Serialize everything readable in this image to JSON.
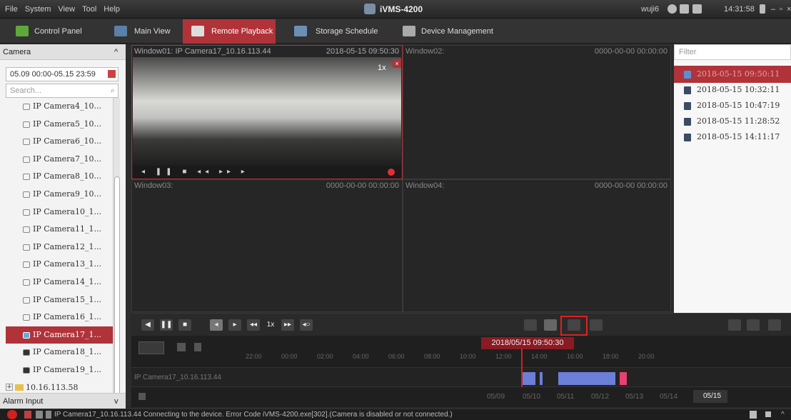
{
  "menubar": {
    "items": [
      "File",
      "System",
      "View",
      "Tool",
      "Help"
    ],
    "app_title": "iVMS-4200",
    "user": "wuji6",
    "clock": "14:31:58"
  },
  "tabs": [
    {
      "label": "Control Panel",
      "icon": "control-panel-icon"
    },
    {
      "label": "Main View",
      "icon": "main-view-icon"
    },
    {
      "label": "Remote Playback",
      "icon": "remote-playback-icon",
      "active": true
    },
    {
      "label": "Storage Schedule",
      "icon": "storage-schedule-icon"
    },
    {
      "label": "Device Management",
      "icon": "device-management-icon"
    }
  ],
  "camera_panel": {
    "title": "Camera",
    "date_range": "05.09 00:00-05.15 23:59",
    "search_placeholder": "Search...",
    "cameras": [
      "IP Camera4_10...",
      "IP Camera5_10...",
      "IP Camera6_10...",
      "IP Camera7_10...",
      "IP Camera8_10...",
      "IP Camera9_10...",
      "IP Camera10_1...",
      "IP Camera11_1...",
      "IP Camera12_1...",
      "IP Camera13_1...",
      "IP Camera14_1...",
      "IP Camera15_1...",
      "IP Camera16_1...",
      "IP Camera17_1...",
      "IP Camera18_1...",
      "IP Camera19_1..."
    ],
    "selected_index": 13,
    "group": "10.16.113.58",
    "alarm_input": "Alarm Input"
  },
  "windows": [
    {
      "title": "Window01: IP Camera17_10.16.113.44",
      "timestamp": "2018-05-15 09:50:30",
      "speed": "1x"
    },
    {
      "title": "Window02:",
      "timestamp": "0000-00-00 00:00:00"
    },
    {
      "title": "Window03:",
      "timestamp": "0000-00-00 00:00:00"
    },
    {
      "title": "Window04:",
      "timestamp": "0000-00-00 00:00:00"
    }
  ],
  "records_panel": {
    "filter_placeholder": "Filter",
    "records": [
      "2018-05-15 09:50:11",
      "2018-05-15 10:32:11",
      "2018-05-15 10:47:19",
      "2018-05-15 11:28:52",
      "2018-05-15 14:11:17"
    ]
  },
  "controls": {
    "speed": "1x"
  },
  "timeline": {
    "current_datetime": "2018/05/15 09:50:30",
    "hour_ticks": [
      "22:00",
      "00:00",
      "02:00",
      "04:00",
      "06:00",
      "08:00",
      "10:00",
      "12:00",
      "14:00",
      "16:00",
      "18:00",
      "20:00"
    ],
    "track_label": "IP Camera17_10.16.113.44",
    "days": [
      "05/09",
      "05/10",
      "05/11",
      "05/12",
      "05/13",
      "05/14"
    ],
    "current_day": "05/15"
  },
  "status": {
    "message": "IP Camera17_10.16.113.44 Connecting to the device. Error Code iVMS-4200.exe[302].(Camera is disabled or not connected.)"
  }
}
